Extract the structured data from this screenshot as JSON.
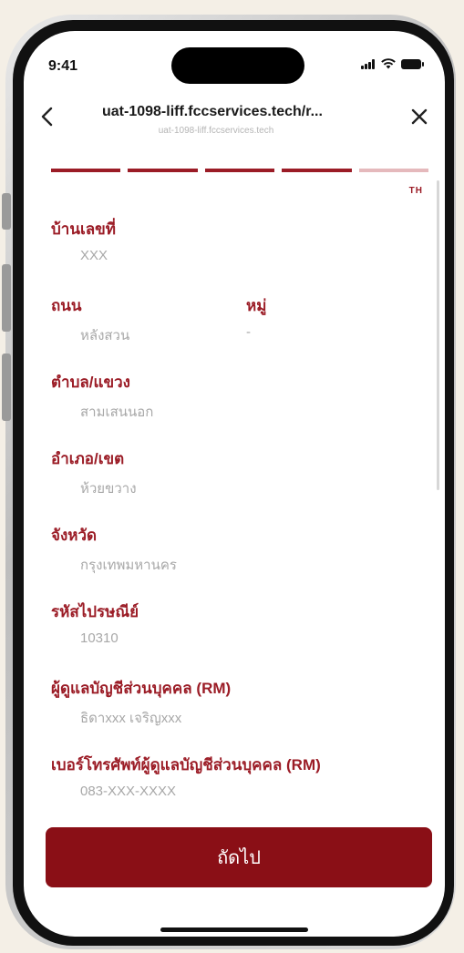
{
  "status_bar": {
    "time": "9:41"
  },
  "header": {
    "back_icon": "chevron-left-icon",
    "title": "uat-1098-liff.fccservices.tech/r...",
    "subtitle": "uat-1098-liff.fccservices.tech",
    "close_icon": "close-icon"
  },
  "progress": {
    "total_steps": 5,
    "completed_steps": 4,
    "active_color": "#9b1c26",
    "inactive_color": "#e5b9bc"
  },
  "language": "TH",
  "form": {
    "house_no": {
      "label": "บ้านเลขที่",
      "value": "XXX"
    },
    "road": {
      "label": "ถนน",
      "value": "หลังสวน"
    },
    "moo": {
      "label": "หมู่",
      "value": "-"
    },
    "subdistrict": {
      "label": "ตำบล/แขวง",
      "value": "สามเสนนอก"
    },
    "district": {
      "label": "อำเภอ/เขต",
      "value": "ห้วยขวาง"
    },
    "province": {
      "label": "จังหวัด",
      "value": "กรุงเทพมหานคร"
    },
    "postal_code": {
      "label": "รหัสไปรษณีย์",
      "value": "10310"
    },
    "rm_name": {
      "label": "ผู้ดูแลบัญชีส่วนบุคคล (RM)",
      "value": "ธิดาxxx เจริญxxx"
    },
    "rm_phone": {
      "label": "เบอร์โทรศัพท์ผู้ดูแลบัญชีส่วนบุคคล (RM)",
      "value": "083-XXX-XXXX"
    }
  },
  "next_button": {
    "label": "ถัดไป",
    "color": "#8a0f16"
  }
}
